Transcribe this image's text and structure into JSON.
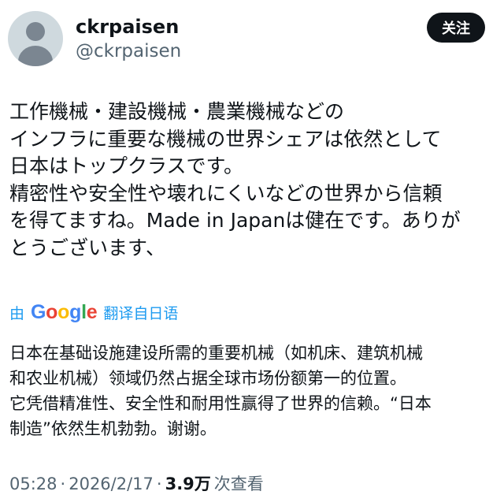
{
  "user": {
    "display_name": "ckrpaisen",
    "handle": "@ckrpaisen"
  },
  "follow_button_label": "关注",
  "tweet": {
    "lines": [
      "工作機械・建設機械・農業機械などの",
      "インフラに重要な機械の世界シェアは依然として",
      "日本はトップクラスです。",
      "精密性や安全性や壊れにくいなどの世界から信頼",
      "を得てますね。Made in Japanは健在です。ありが",
      "とうございます、"
    ]
  },
  "translation": {
    "by_label": "由",
    "google_letters": [
      "G",
      "o",
      "o",
      "g",
      "l",
      "e"
    ],
    "source_label": "翻译自日语",
    "lines": [
      "日本在基础设施建设所需的重要机械（如机床、建筑机械",
      "和农业机械）领域仍然占据全球市场份额第一的位置。",
      "它凭借精准性、安全性和耐用性赢得了世界的信赖。“日本",
      "制造”依然生机勃勃。谢谢。"
    ]
  },
  "meta": {
    "time": "05:28",
    "date": "2026/2/17",
    "separator": "·",
    "views_count": "3.9万",
    "views_label": "次查看"
  },
  "colors": {
    "text": "#0f1419",
    "secondary": "#536471",
    "link": "#1d9bf0",
    "follow_bg": "#0f1419",
    "google_blue": "#4285f4",
    "google_red": "#ea4335",
    "google_yellow": "#fbbc05",
    "google_green": "#34a853"
  }
}
